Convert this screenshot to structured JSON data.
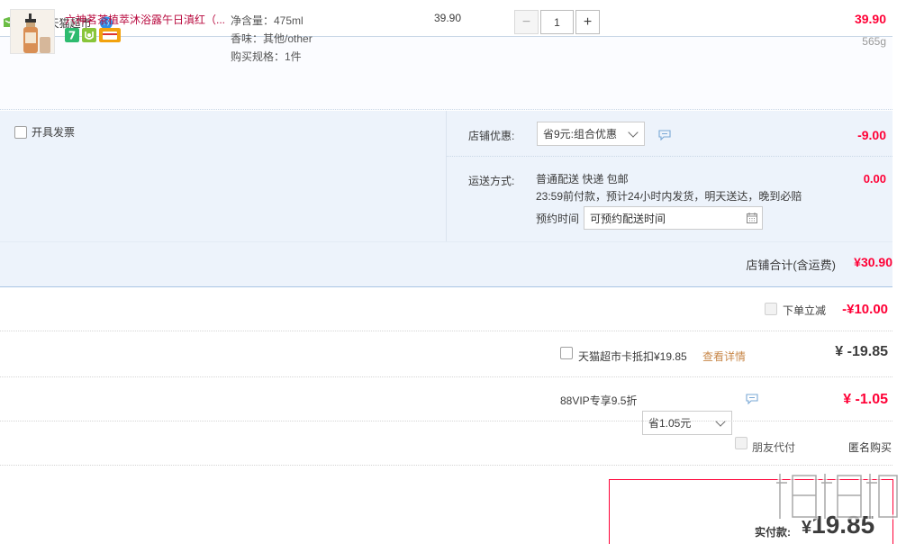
{
  "shop": {
    "label": "店铺: 天猫超市",
    "icon": "shop-icon",
    "chat_icon": "wangwang-chat-icon"
  },
  "item": {
    "title": "六神茗茶植萃沐浴露午日滇红（...",
    "badges": [
      "7-day-return-badge",
      "tmall-guarantee-badge",
      "card-payment-badge"
    ],
    "badge_texts": [
      "7"
    ],
    "attrs": [
      "净含量：475ml",
      "香味：其他/other",
      "购买规格：1件"
    ],
    "unit_price": "39.90",
    "quantity": "1",
    "subtotal": "39.90",
    "weight": "565g"
  },
  "invoice": {
    "label": "开具发票",
    "checked": false
  },
  "store_discount": {
    "label": "店铺优惠:",
    "selected": "省9元:组合优惠",
    "amount": "-9.00"
  },
  "shipping": {
    "label": "运送方式:",
    "line1": "普通配送 快递 包邮",
    "line2": "23:59前付款，预计24小时内发货，明天送达，晚到必赔",
    "appoint_label": "预约时间",
    "appoint_placeholder": "可预约配送时间",
    "amount": "0.00"
  },
  "shop_total": {
    "label": "店铺合计(含运费)",
    "value": "¥30.90"
  },
  "instant_discount": {
    "label": "下单立减",
    "value": "-¥10.00"
  },
  "tmall_card": {
    "label": "天猫超市卡抵扣¥19.85",
    "link": "查看详情",
    "value": "¥ -19.85"
  },
  "vip": {
    "label": "88VIP专享9.5折",
    "selected": "省1.05元",
    "value": "¥ -1.05"
  },
  "options": {
    "friend_pay": "朋友代付",
    "anonymous": "匿名购买",
    "anonymous_checked": true
  },
  "pay": {
    "label": "实付款:",
    "currency": "¥",
    "amount": "19.85"
  },
  "colors": {
    "accent_red": "#ff0036",
    "title_red": "#b8093e",
    "panel_bg": "#edf3fb",
    "link_orange": "#c8884a",
    "checkbox_blue": "#3b7ee0"
  }
}
